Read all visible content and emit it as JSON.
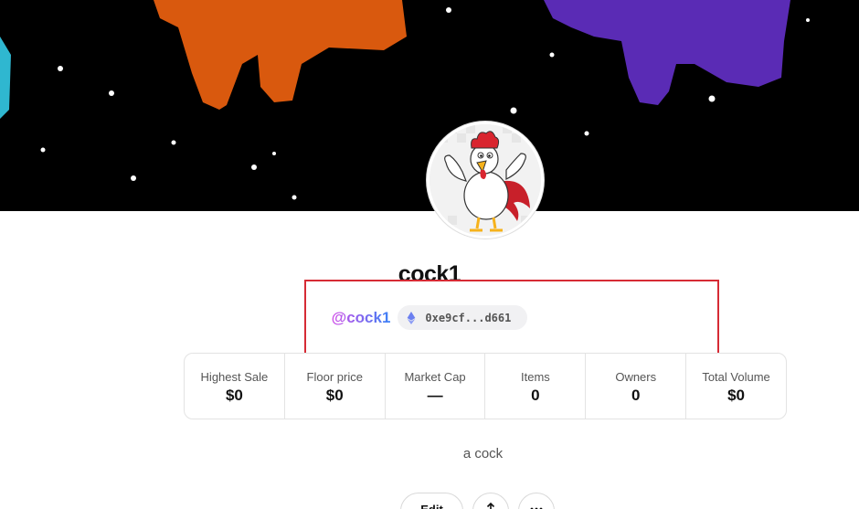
{
  "collection": {
    "name": "cock1",
    "handle": "@cock1",
    "address": "0xe9cf...d661",
    "description": "a cock"
  },
  "stats": [
    {
      "label": "Highest Sale",
      "value": "$0"
    },
    {
      "label": "Floor price",
      "value": "$0"
    },
    {
      "label": "Market Cap",
      "value": "—"
    },
    {
      "label": "Items",
      "value": "0"
    },
    {
      "label": "Owners",
      "value": "0"
    },
    {
      "label": "Total Volume",
      "value": "$0"
    }
  ],
  "actions": {
    "edit_label": "Edit"
  },
  "icons": {
    "address": "ethereum-icon",
    "share": "share-icon",
    "more": "more-icon"
  },
  "colors": {
    "handle_gradient_start": "#d04ce8",
    "handle_gradient_end": "#3b82f6",
    "highlight": "#d62b35"
  }
}
